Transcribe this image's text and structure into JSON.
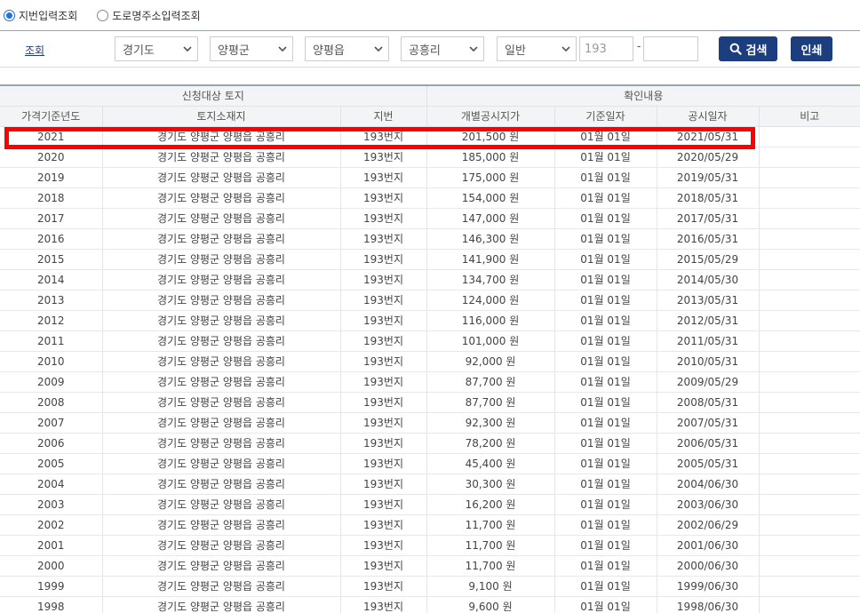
{
  "radio": {
    "options": [
      {
        "label": "지번입력조회",
        "selected": true
      },
      {
        "label": "도로명주소입력조회",
        "selected": false
      }
    ]
  },
  "search": {
    "label": "조회",
    "province": "경기도",
    "county": "양평군",
    "town": "양평읍",
    "village": "공흥리",
    "land_type": "일반",
    "main_no": "193",
    "sub_no": "",
    "dash": "-",
    "search_button": "검색",
    "print_button": "인쇄"
  },
  "table": {
    "group_headers": {
      "left": "신청대상 토지",
      "right": "확인내용"
    },
    "columns": [
      "가격기준년도",
      "토지소재지",
      "지번",
      "개별공시지가",
      "기준일자",
      "공시일자",
      "비고"
    ],
    "rows": [
      [
        "2021",
        "경기도 양평군 양평읍 공흥리",
        "193번지",
        "201,500 원",
        "01월 01일",
        "2021/05/31",
        ""
      ],
      [
        "2020",
        "경기도 양평군 양평읍 공흥리",
        "193번지",
        "185,000 원",
        "01월 01일",
        "2020/05/29",
        ""
      ],
      [
        "2019",
        "경기도 양평군 양평읍 공흥리",
        "193번지",
        "175,000 원",
        "01월 01일",
        "2019/05/31",
        ""
      ],
      [
        "2018",
        "경기도 양평군 양평읍 공흥리",
        "193번지",
        "154,000 원",
        "01월 01일",
        "2018/05/31",
        ""
      ],
      [
        "2017",
        "경기도 양평군 양평읍 공흥리",
        "193번지",
        "147,000 원",
        "01월 01일",
        "2017/05/31",
        ""
      ],
      [
        "2016",
        "경기도 양평군 양평읍 공흥리",
        "193번지",
        "146,300 원",
        "01월 01일",
        "2016/05/31",
        ""
      ],
      [
        "2015",
        "경기도 양평군 양평읍 공흥리",
        "193번지",
        "141,900 원",
        "01월 01일",
        "2015/05/29",
        ""
      ],
      [
        "2014",
        "경기도 양평군 양평읍 공흥리",
        "193번지",
        "134,700 원",
        "01월 01일",
        "2014/05/30",
        ""
      ],
      [
        "2013",
        "경기도 양평군 양평읍 공흥리",
        "193번지",
        "124,000 원",
        "01월 01일",
        "2013/05/31",
        ""
      ],
      [
        "2012",
        "경기도 양평군 양평읍 공흥리",
        "193번지",
        "116,000 원",
        "01월 01일",
        "2012/05/31",
        ""
      ],
      [
        "2011",
        "경기도 양평군 양평읍 공흥리",
        "193번지",
        "101,000 원",
        "01월 01일",
        "2011/05/31",
        ""
      ],
      [
        "2010",
        "경기도 양평군 양평읍 공흥리",
        "193번지",
        "92,000 원",
        "01월 01일",
        "2010/05/31",
        ""
      ],
      [
        "2009",
        "경기도 양평군 양평읍 공흥리",
        "193번지",
        "87,700 원",
        "01월 01일",
        "2009/05/29",
        ""
      ],
      [
        "2008",
        "경기도 양평군 양평읍 공흥리",
        "193번지",
        "87,700 원",
        "01월 01일",
        "2008/05/31",
        ""
      ],
      [
        "2007",
        "경기도 양평군 양평읍 공흥리",
        "193번지",
        "92,300 원",
        "01월 01일",
        "2007/05/31",
        ""
      ],
      [
        "2006",
        "경기도 양평군 양평읍 공흥리",
        "193번지",
        "78,200 원",
        "01월 01일",
        "2006/05/31",
        ""
      ],
      [
        "2005",
        "경기도 양평군 양평읍 공흥리",
        "193번지",
        "45,400 원",
        "01월 01일",
        "2005/05/31",
        ""
      ],
      [
        "2004",
        "경기도 양평군 양평읍 공흥리",
        "193번지",
        "30,300 원",
        "01월 01일",
        "2004/06/30",
        ""
      ],
      [
        "2003",
        "경기도 양평군 양평읍 공흥리",
        "193번지",
        "16,200 원",
        "01월 01일",
        "2003/06/30",
        ""
      ],
      [
        "2002",
        "경기도 양평군 양평읍 공흥리",
        "193번지",
        "11,700 원",
        "01월 01일",
        "2002/06/29",
        ""
      ],
      [
        "2001",
        "경기도 양평군 양평읍 공흥리",
        "193번지",
        "11,700 원",
        "01월 01일",
        "2001/06/30",
        ""
      ],
      [
        "2000",
        "경기도 양평군 양평읍 공흥리",
        "193번지",
        "11,700 원",
        "01월 01일",
        "2000/06/30",
        ""
      ],
      [
        "1999",
        "경기도 양평군 양평읍 공흥리",
        "193번지",
        "9,100 원",
        "01월 01일",
        "1999/06/30",
        ""
      ],
      [
        "1998",
        "경기도 양평군 양평읍 공흥리",
        "193번지",
        "9,600 원",
        "01월 01일",
        "1998/06/30",
        ""
      ]
    ]
  },
  "colors": {
    "accent": "#1c3d7e",
    "highlight": "#ff0000",
    "radio_selected": "#1a73e8"
  }
}
